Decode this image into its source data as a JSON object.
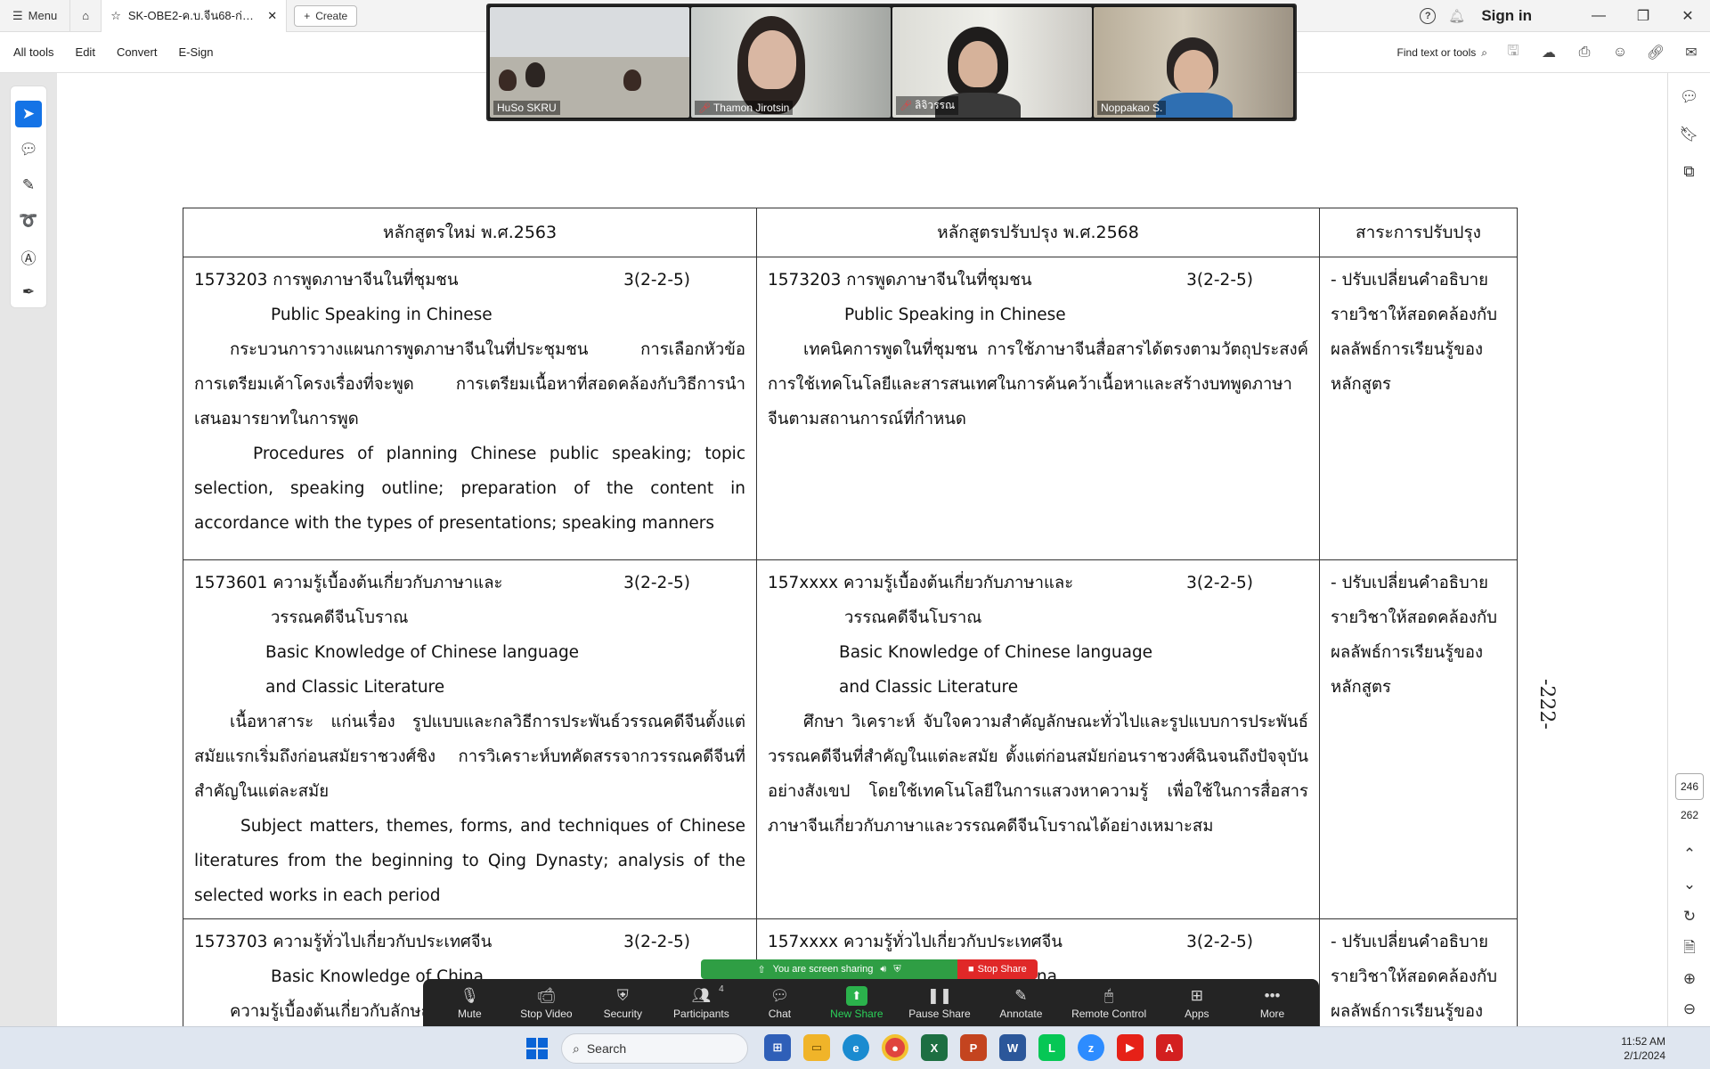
{
  "tabbar": {
    "menu_label": "Menu",
    "doc_tab_title": "SK-OBE2-ค.บ.จีน68-ก่อนเร...",
    "create_label": "Create",
    "help_icon": "?",
    "sign_in": "Sign in",
    "minimize": "—",
    "restore": "❐",
    "close": "✕"
  },
  "toolbar": {
    "items": [
      "All tools",
      "Edit",
      "Convert",
      "E-Sign"
    ],
    "find_label": "Find text or tools"
  },
  "video": {
    "participants": [
      {
        "name": "HuSo SKRU",
        "muted": false
      },
      {
        "name": "Thamon Jirotsin",
        "muted": true
      },
      {
        "name": "ลิจิวรรณ",
        "muted": true
      },
      {
        "name": "Noppakao S.",
        "muted": false
      }
    ]
  },
  "document": {
    "page_number_text": "-222-",
    "headers": [
      "หลักสูตรใหม่ พ.ศ.2563",
      "หลักสูตรปรับปรุง พ.ศ.2568",
      "สาระการปรับปรุง"
    ],
    "rows": [
      {
        "old": {
          "code": "1573203 การพูดภาษาจีนในที่ชุมชน",
          "credit": "3(2-2-5)",
          "title_en": "Public Speaking in Chinese",
          "desc_th": "กระบวนการวางแผนการพูดภาษาจีนในที่ประชุมชน การเลือกหัวข้อ การเตรียมเค้าโครงเรื่องที่จะพูด การเตรียมเนื้อหาที่สอดคล้องกับวิธีการนำเสนอมารยาทในการพูด",
          "desc_en": "Procedures of planning Chinese public speaking; topic selection, speaking outline; preparation of the content in accordance with the types of presentations; speaking manners"
        },
        "new": {
          "code": "1573203 การพูดภาษาจีนในที่ชุมชน",
          "credit": "3(2-2-5)",
          "title_en": "Public Speaking in Chinese",
          "desc_th": "เทคนิคการพูดในที่ชุมชน การใช้ภาษาจีนสื่อสารได้ตรงตามวัตถุประสงค์ การใช้เทคโนโลยีและสารสนเทศในการค้นคว้าเนื้อหาและสร้างบทพูดภาษาจีนตามสถานการณ์ที่กำหนด"
        },
        "note": "- ปรับเปลี่ยนคำอธิบายรายวิชาให้สอดคล้องกับผลลัพธ์การเรียนรู้ของหลักสูตร"
      },
      {
        "old": {
          "code": "1573601 ความรู้เบื้องต้นเกี่ยวกับภาษาและ",
          "credit": "3(2-2-5)",
          "code_cont": "วรรณคดีจีนโบราณ",
          "title_en_1": "Basic Knowledge of Chinese language",
          "title_en_2": "and Classic Literature",
          "desc_th": "เนื้อหาสาระ แก่นเรื่อง รูปแบบและกลวิธีการประพันธ์วรรณคดีจีนตั้งแต่สมัยแรกเริ่มถึงก่อนสมัยราชวงศ์ชิง การวิเคราะห์บทคัดสรรจากวรรณคดีจีนที่สำคัญในแต่ละสมัย",
          "desc_en": "Subject matters, themes, forms, and techniques of Chinese literatures from the beginning to Qing Dynasty; analysis of the selected works in each period"
        },
        "new": {
          "code": "157xxxx ความรู้เบื้องต้นเกี่ยวกับภาษาและ",
          "credit": "3(2-2-5)",
          "code_cont": "วรรณคดีจีนโบราณ",
          "title_en_1": "Basic Knowledge of Chinese language",
          "title_en_2": "and Classic Literature",
          "desc_th": "ศึกษา วิเคราะห์ จับใจความสำคัญลักษณะทั่วไปและรูปแบบการประพันธ์วรรณคดีจีนที่สำคัญในแต่ละสมัย ตั้งแต่ก่อนสมัยก่อนราชวงศ์ฉินจนถึงปัจจุบันอย่างสังเขป โดยใช้เทคโนโลยีในการแสวงหาความรู้ เพื่อใช้ในการสื่อสารภาษาจีนเกี่ยวกับภาษาและวรรณคดีจีนโบราณได้อย่างเหมาะสม"
        },
        "note": "- ปรับเปลี่ยนคำอธิบายรายวิชาให้สอดคล้องกับผลลัพธ์การเรียนรู้ของหลักสูตร"
      },
      {
        "old": {
          "code": "1573703 ความรู้ทั่วไปเกี่ยวกับประเทศจีน",
          "credit": "3(2-2-5)",
          "title_en": "Basic Knowledge of China",
          "desc_th": "ความรู้เบื้องต้นเกี่ยวกับลักษณะภูมิศาสตร์ของประเทศจีน"
        },
        "new": {
          "code": "157xxxx ความรู้ทั่วไปเกี่ยวกับประเทศจีน",
          "credit": "3(2-2-5)",
          "title_en": "Basic Knowledge of China"
        },
        "note": "- ปรับเปลี่ยนคำอธิบายรายวิชาให้สอดคล้องกับผลลัพธ์การเรียนรู้ของหลักสูตร"
      }
    ]
  },
  "right_rail": {
    "current_page": "246",
    "total_pages": "262"
  },
  "zoom": {
    "sharing_text": "You are screen sharing",
    "stop_share": "Stop Share",
    "participants_count": "4",
    "buttons": [
      {
        "icon": "mic-icon",
        "label": "Mute"
      },
      {
        "icon": "video-icon",
        "label": "Stop Video"
      },
      {
        "icon": "shield-icon",
        "label": "Security"
      },
      {
        "icon": "participants-icon",
        "label": "Participants"
      },
      {
        "icon": "chat-icon",
        "label": "Chat"
      },
      {
        "icon": "share-icon",
        "label": "New Share"
      },
      {
        "icon": "pause-icon",
        "label": "Pause Share"
      },
      {
        "icon": "pencil-icon",
        "label": "Annotate"
      },
      {
        "icon": "remote-icon",
        "label": "Remote Control"
      },
      {
        "icon": "apps-icon",
        "label": "Apps"
      },
      {
        "icon": "more-icon",
        "label": "More"
      }
    ]
  },
  "taskbar": {
    "search_placeholder": "Search",
    "time": "11:52 AM",
    "date": "2/1/2024"
  }
}
